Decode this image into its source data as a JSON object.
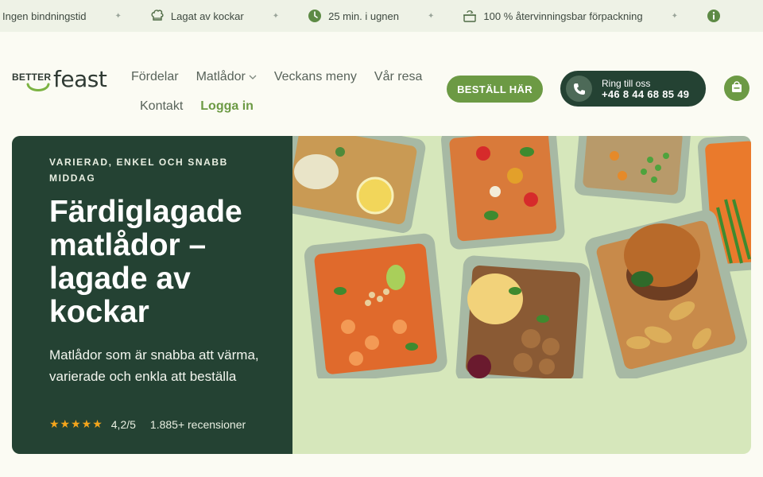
{
  "usp_bar": {
    "items": [
      {
        "icon": "check-icon",
        "text": "Ingen bindningstid"
      },
      {
        "icon": "chef-hat-icon",
        "text": "Lagat av kockar"
      },
      {
        "icon": "clock-icon",
        "text": "25 min. i ugnen"
      },
      {
        "icon": "recycle-box-icon",
        "text": "100 % återvinningsbar förpackning"
      },
      {
        "icon": "info-icon",
        "text": ""
      }
    ],
    "separator": "✦"
  },
  "header": {
    "logo": {
      "better": "BETTER",
      "feast": "feast"
    },
    "nav": {
      "fordelar": "Fördelar",
      "matlador": "Matlådor",
      "veckans_meny": "Veckans meny",
      "var_resa": "Vår resa",
      "kontakt": "Kontakt",
      "logga_in": "Logga in"
    },
    "order_button": "BESTÄLL HÄR",
    "call": {
      "label": "Ring till oss",
      "number": "+46 8 44 68 85 49"
    }
  },
  "hero": {
    "eyebrow": "VARIERAD, ENKEL OCH SNABB MIDDAG",
    "title": "Färdiglagade matlådor – lagade av kockar",
    "subtitle": "Matlådor som är snabba att värma, varierade och enkla att beställa",
    "rating": {
      "stars": "★★★★★",
      "score": "4,2/5",
      "reviews": "1.885+ recensioner"
    }
  },
  "colors": {
    "brand_green": "#6c9a44",
    "dark_green": "#244233",
    "hero_bg": "#d6e7bb",
    "usp_bg": "#eef2e6",
    "page_bg": "#fbfbf3",
    "star": "#f4a51c"
  }
}
